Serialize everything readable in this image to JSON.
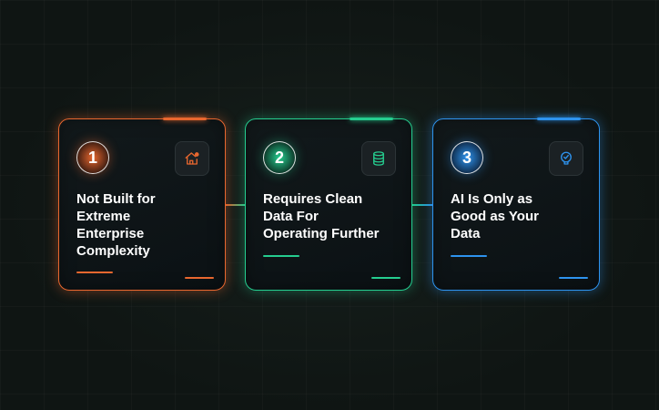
{
  "colors": {
    "orange": "#e8672f",
    "green": "#25cd8f",
    "blue": "#2e93ee",
    "background": "#0f1513"
  },
  "cards": [
    {
      "number": "1",
      "title": "Not Built for\nExtreme\nEnterprise\nComplexity",
      "icon": "house-chart-icon",
      "accent": "orange"
    },
    {
      "number": "2",
      "title": "Requires Clean\nData For\nOperating Further",
      "icon": "database-icon",
      "accent": "green"
    },
    {
      "number": "3",
      "title": "AI Is Only as\nGood as Your\nData",
      "icon": "lightbulb-check-icon",
      "accent": "blue"
    }
  ]
}
